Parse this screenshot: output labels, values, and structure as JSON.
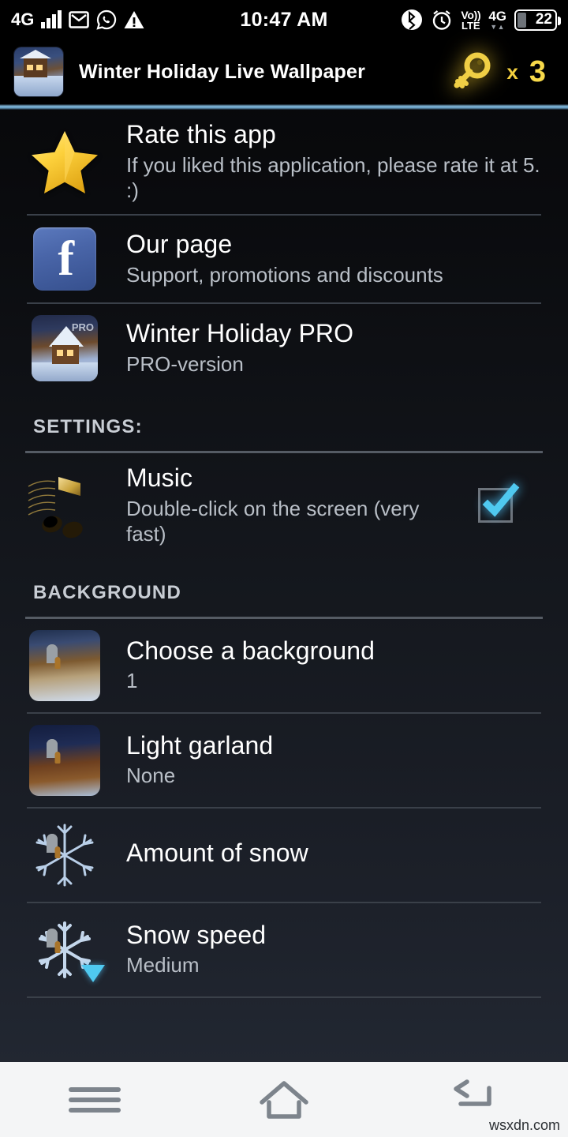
{
  "status_bar": {
    "network_label": "4G",
    "signal_icon": "signal-bars-icon",
    "mail_icon": "mail-icon",
    "whatsapp_icon": "whatsapp-icon",
    "warning_icon": "warning-triangle-icon",
    "clock": "10:47 AM",
    "bluetooth_icon": "bluetooth-icon",
    "alarm_icon": "alarm-clock-icon",
    "volte_top": "Vo))",
    "volte_bottom": "LTE",
    "network2_label": "4G",
    "data_arrows": "▼▲",
    "battery_level": "22"
  },
  "app_bar": {
    "app_icon": "winter-cabin-app-icon",
    "title": "Winter Holiday Live Wallpaper",
    "key_icon": "gold-key-icon",
    "key_multiplier": "x",
    "key_count": "3",
    "accent_color": "#7fb3d5"
  },
  "list": [
    {
      "id": "rate-this-app",
      "icon": "gold-star-icon",
      "title": "Rate this app",
      "subtitle": "If you liked this application, please rate it at 5. :)"
    },
    {
      "id": "our-page",
      "icon": "facebook-icon",
      "title": "Our page",
      "subtitle": "Support, promotions and discounts"
    },
    {
      "id": "winter-holiday-pro",
      "icon": "winter-holiday-pro-icon",
      "icon_tag": "PRO",
      "title": "Winter Holiday PRO",
      "subtitle": "PRO-version"
    }
  ],
  "settings_section": {
    "header": "SETTINGS:",
    "music": {
      "id": "music",
      "icon": "music-notes-icon",
      "title": "Music",
      "subtitle": "Double-click on the screen (very fast)",
      "checkbox": "checkbox-checked-icon",
      "checked": true,
      "check_color": "#4fc9f0"
    }
  },
  "background_section": {
    "header": "BACKGROUND",
    "items": [
      {
        "id": "choose-a-background",
        "icon": "locked-cabin-icon",
        "lock": "padlock-icon",
        "title": "Choose a background",
        "subtitle": "1"
      },
      {
        "id": "light-garland",
        "icon": "locked-garland-cabin-icon",
        "lock": "padlock-icon",
        "title": "Light garland",
        "subtitle": "None"
      },
      {
        "id": "amount-of-snow",
        "icon": "locked-snowflake-icon",
        "lock": "padlock-icon",
        "title": "Amount of snow",
        "subtitle": ""
      },
      {
        "id": "snow-speed",
        "icon": "locked-snowflake-icon",
        "lock": "padlock-icon",
        "dropdown": "triangle-down-icon",
        "title": "Snow speed",
        "subtitle": "Medium"
      }
    ]
  },
  "nav_bar": {
    "menu_icon": "menu-icon",
    "home_icon": "home-icon",
    "back_icon": "back-icon"
  },
  "watermark": "wsxdn.com"
}
